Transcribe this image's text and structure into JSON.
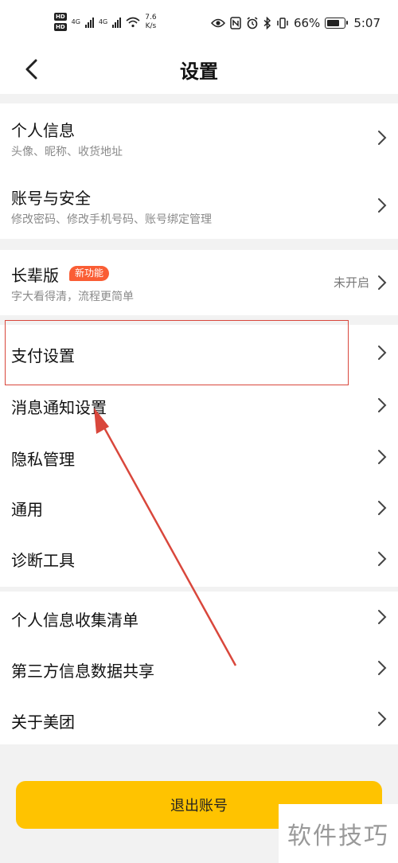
{
  "status_bar": {
    "net_left_1": "4G",
    "net_left_2": "4G",
    "speed_value": "7.6",
    "speed_unit": "K/s",
    "battery": "66%",
    "time": "5:07"
  },
  "nav": {
    "title": "设置"
  },
  "group1": [
    {
      "title": "个人信息",
      "subtitle": "头像、昵称、收货地址"
    },
    {
      "title": "账号与安全",
      "subtitle": "修改密码、修改手机号码、账号绑定管理"
    }
  ],
  "elder": {
    "title": "长辈版",
    "badge": "新功能",
    "subtitle": "字大看得清，流程更简单",
    "status": "未开启"
  },
  "group2": [
    "支付设置",
    "消息通知设置",
    "隐私管理",
    "通用",
    "诊断工具"
  ],
  "group3": [
    "个人信息收集清单",
    "第三方信息数据共享",
    "关于美团"
  ],
  "logout_label": "退出账号",
  "watermark_text": "软件技巧",
  "colors": {
    "accent": "#ffc300",
    "badge": "#fa5d34",
    "annotation": "#d9473c"
  }
}
